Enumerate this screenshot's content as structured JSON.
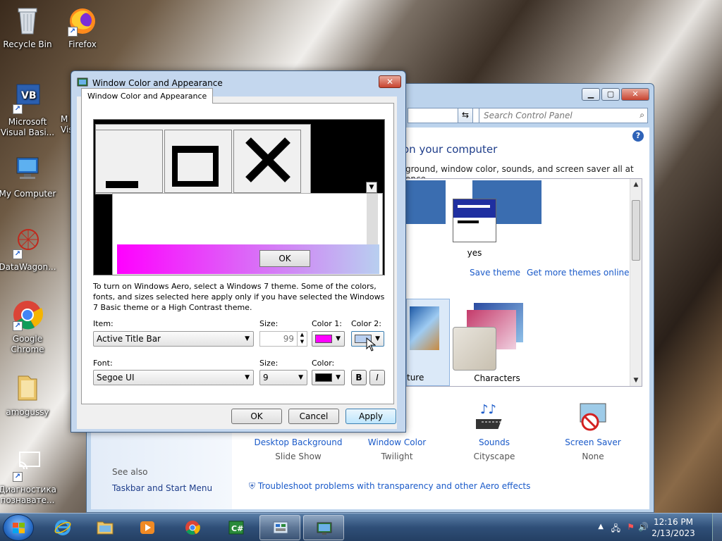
{
  "desktop": {
    "icons": [
      {
        "label": "Recycle Bin"
      },
      {
        "label": "Firefox"
      },
      {
        "label": "Microsoft Visual Basi..."
      },
      {
        "label": "M Vis"
      },
      {
        "label": "My Computer"
      },
      {
        "label": "DataWagon..."
      },
      {
        "label": "Google Chrome"
      },
      {
        "label": "amogussy"
      },
      {
        "label": "Диагностика познавате..."
      }
    ]
  },
  "control_panel": {
    "search_placeholder": "Search Control Panel",
    "heading": "on your computer",
    "subtext": "ground, window color, sounds, and screen saver all at once.",
    "theme_label": "yes",
    "save_theme": "Save theme",
    "get_more_themes": "Get more themes online",
    "theme2_label": "ture",
    "theme3_label": "Characters",
    "see_also": "See also",
    "taskbar_link": "Taskbar and Start Menu",
    "bottom": [
      {
        "title": "Desktop Background",
        "sub": "Slide Show"
      },
      {
        "title": "Window Color",
        "sub": "Twilight"
      },
      {
        "title": "Sounds",
        "sub": "Cityscape"
      },
      {
        "title": "Screen Saver",
        "sub": "None"
      }
    ],
    "troubleshoot": "Troubleshoot problems with transparency and other Aero effects"
  },
  "dialog": {
    "title": "Window Color and Appearance",
    "tab": "Window Color and Appearance",
    "preview_ok": "OK",
    "description": "To turn on Windows Aero, select a Windows 7 theme.  Some of the colors, fonts, and sizes selected here apply only if you have selected the Windows 7 Basic theme or a High Contrast theme.",
    "item_label": "Item:",
    "item_value": "Active Title Bar",
    "size_label": "Size:",
    "size_value": "99",
    "color1_label": "Color 1:",
    "color2_label": "Color 2:",
    "font_label": "Font:",
    "font_value": "Segoe UI",
    "font_size_label": "Size:",
    "font_size_value": "9",
    "font_color_label": "Color:",
    "bold": "B",
    "italic": "I",
    "ok": "OK",
    "cancel": "Cancel",
    "apply": "Apply",
    "colors": {
      "color1": "#ff00ff",
      "color2": "#b8cff0",
      "font_color": "#000000"
    }
  },
  "taskbar": {
    "time": "12:16 PM",
    "date": "2/13/2023"
  }
}
